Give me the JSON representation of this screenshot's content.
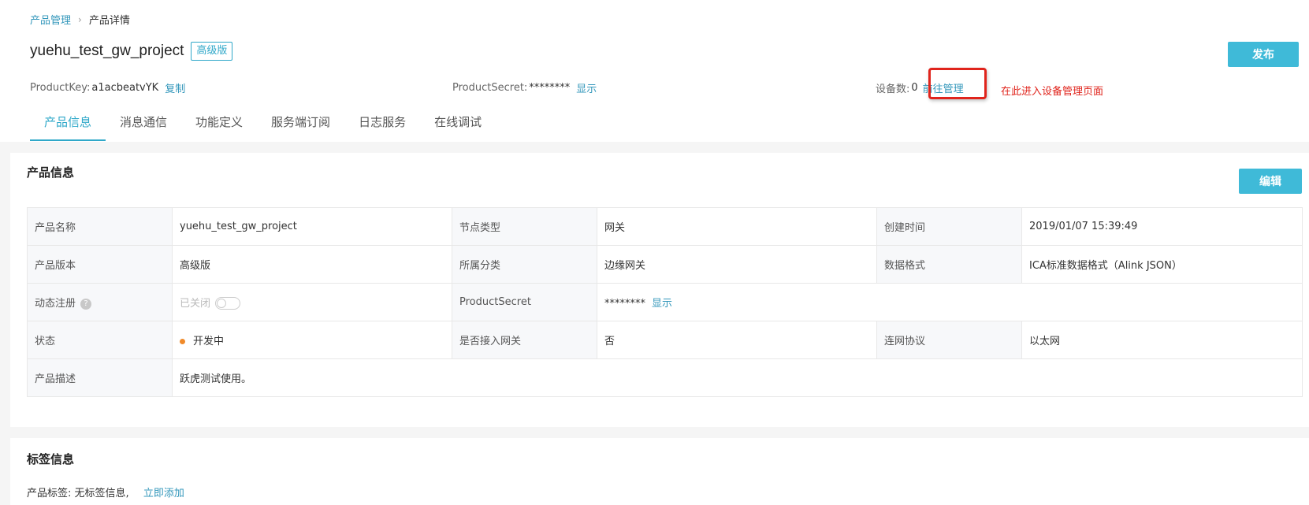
{
  "breadcrumb": {
    "parent": "产品管理",
    "separator": "›",
    "current": "产品详情"
  },
  "product": {
    "title": "yuehu_test_gw_project",
    "edition_badge": "高级版"
  },
  "toolbar": {
    "publish_label": "发布"
  },
  "meta": {
    "product_key_label": "ProductKey:",
    "product_key_value": "a1acbeatvYK",
    "copy_label": "复制",
    "product_secret_label": "ProductSecret:",
    "product_secret_value": "********",
    "show_label": "显示",
    "device_count_label": "设备数:",
    "device_count_value": "0",
    "manage_label": "前往管理"
  },
  "annotation": {
    "text": "在此进入设备管理页面",
    "color": "#e0241c"
  },
  "tabs": [
    {
      "label": "产品信息",
      "active": true
    },
    {
      "label": "消息通信"
    },
    {
      "label": "功能定义"
    },
    {
      "label": "服务端订阅"
    },
    {
      "label": "日志服务"
    },
    {
      "label": "在线调试"
    }
  ],
  "info_card": {
    "title": "产品信息",
    "edit_label": "编辑",
    "rows": {
      "r1": {
        "l1": "产品名称",
        "v1": "yuehu_test_gw_project",
        "l2": "节点类型",
        "v2": "网关",
        "l3": "创建时间",
        "v3": "2019/01/07 15:39:49"
      },
      "r2": {
        "l1": "产品版本",
        "v1": "高级版",
        "l2": "所属分类",
        "v2": "边缘网关",
        "l3": "数据格式",
        "v3": "ICA标准数据格式（Alink JSON）"
      },
      "r3": {
        "l1": "动态注册",
        "help": "?",
        "v1": "已关闭",
        "toggle_on": false,
        "l2": "ProductSecret",
        "v2": "********",
        "v2_link": "显示"
      },
      "r4": {
        "l1": "状态",
        "v1": "开发中",
        "status_color": "#f08a2a",
        "l2": "是否接入网关",
        "v2": "否",
        "l3": "连网协议",
        "v3": "以太网"
      },
      "r5": {
        "l1": "产品描述",
        "v1": "跃虎测试使用。"
      }
    }
  },
  "tags_card": {
    "title": "标签信息",
    "label": "产品标签:",
    "value": "无标签信息,",
    "add_label": "立即添加"
  },
  "colors": {
    "accent": "#3fbad8",
    "link": "#3397bb"
  }
}
